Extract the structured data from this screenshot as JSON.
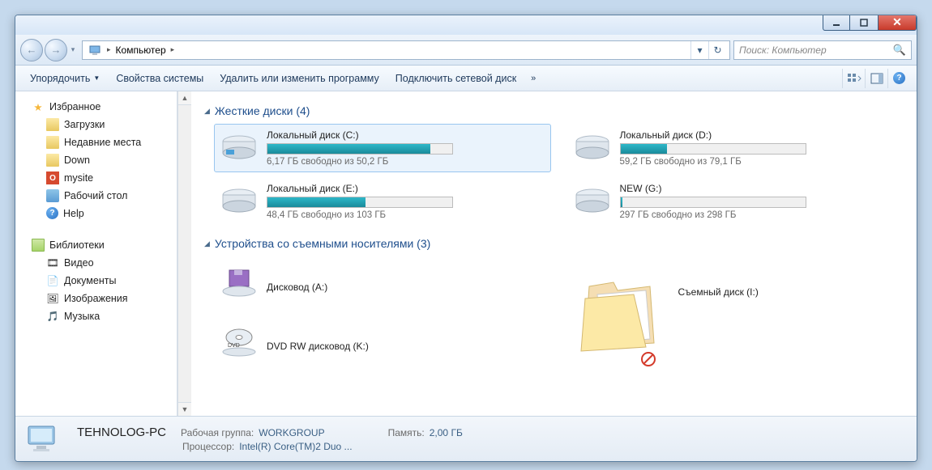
{
  "breadcrumb": {
    "root_label": "Компьютер"
  },
  "search": {
    "placeholder": "Поиск: Компьютер"
  },
  "toolbar": {
    "organize": "Упорядочить",
    "props": "Свойства системы",
    "uninstall": "Удалить или изменить программу",
    "mapdrive": "Подключить сетевой диск",
    "chevron": "»"
  },
  "nav": {
    "favorites": {
      "header": "Избранное",
      "items": [
        "Загрузки",
        "Недавние места",
        "Down",
        "mysite",
        "Рабочий стол",
        "Help"
      ]
    },
    "libraries": {
      "header": "Библиотеки",
      "items": [
        "Видео",
        "Документы",
        "Изображения",
        "Музыка"
      ]
    }
  },
  "sections": {
    "hdd": {
      "title": "Жесткие диски (4)"
    },
    "removable": {
      "title": "Устройства со съемными носителями (3)"
    }
  },
  "drives": {
    "c": {
      "name": "Локальный диск (C:)",
      "free": "6,17 ГБ свободно из 50,2 ГБ",
      "fill_pct": 88
    },
    "d": {
      "name": "Локальный диск (D:)",
      "free": "59,2 ГБ свободно из 79,1 ГБ",
      "fill_pct": 25
    },
    "e": {
      "name": "Локальный диск (E:)",
      "free": "48,4 ГБ свободно из 103 ГБ",
      "fill_pct": 53
    },
    "g": {
      "name": "NEW (G:)",
      "free": "297 ГБ свободно из 298 ГБ",
      "fill_pct": 1
    }
  },
  "removable": {
    "a": {
      "name": "Дисковод (A:)"
    },
    "k": {
      "name": "DVD RW дисковод (K:)"
    },
    "i": {
      "name": "Съемный диск (I:)"
    }
  },
  "status": {
    "pcname": "TEHNOLOG-PC",
    "workgroup_k": "Рабочая группа:",
    "workgroup_v": "WORKGROUP",
    "cpu_k": "Процессор:",
    "cpu_v": "Intel(R) Core(TM)2 Duo ...",
    "mem_k": "Память:",
    "mem_v": "2,00 ГБ"
  }
}
